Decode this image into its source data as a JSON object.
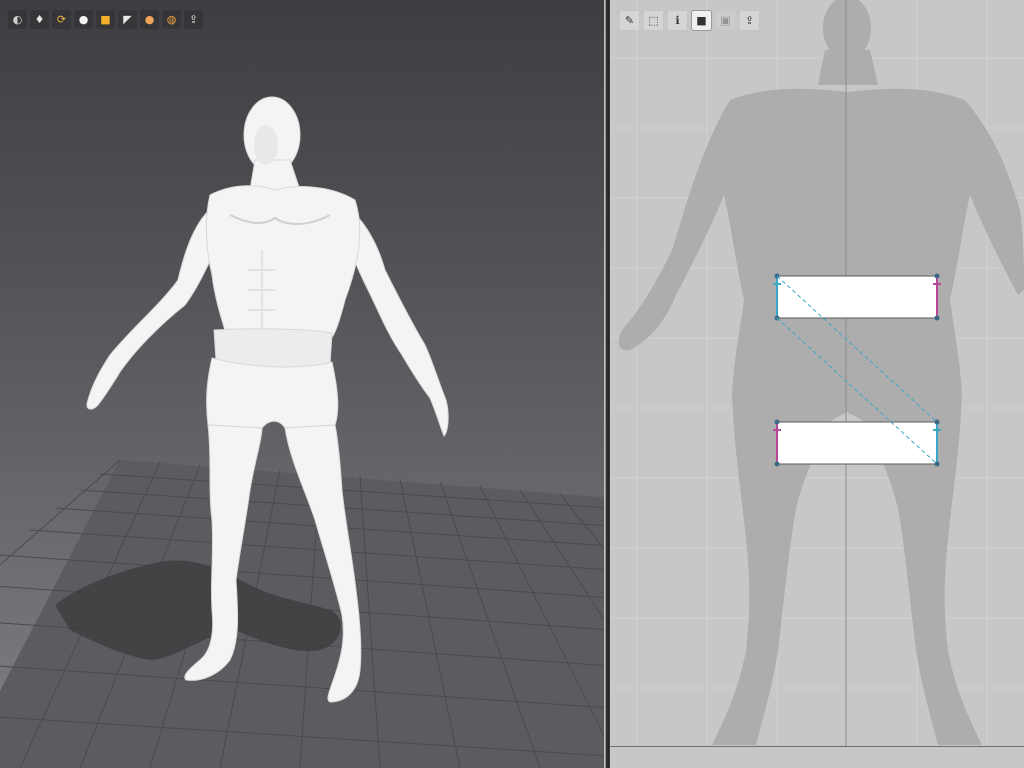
{
  "viewport_3d": {
    "toolbar": [
      {
        "icon": "orbit-icon",
        "glyph": "◐",
        "color": "#cfcfcf"
      },
      {
        "icon": "shirt-icon",
        "glyph": "♦",
        "color": "#e6e6e6"
      },
      {
        "icon": "refresh-icon",
        "glyph": "⟳",
        "color": "#f2b63c"
      },
      {
        "icon": "avatar-icon",
        "glyph": "●",
        "color": "#f2f2f2"
      },
      {
        "icon": "fabric-icon",
        "glyph": "■",
        "color": "#f3b02a"
      },
      {
        "icon": "flag-icon",
        "glyph": "◤",
        "color": "#e8e8e8"
      },
      {
        "icon": "person-icon",
        "glyph": "●",
        "color": "#f0a35a"
      },
      {
        "icon": "globe-icon",
        "glyph": "◍",
        "color": "#e9a23b"
      },
      {
        "icon": "export-icon",
        "glyph": "⇪",
        "color": "#dadada"
      }
    ],
    "ground_color": "#5b5c5f",
    "avatar_color": "#f4f4f4"
  },
  "viewport_2d": {
    "toolbar": [
      {
        "icon": "edit-pattern-icon",
        "glyph": "✎",
        "active": false,
        "disabled": false
      },
      {
        "icon": "transform-icon",
        "glyph": "⬚",
        "active": false,
        "disabled": false
      },
      {
        "icon": "info-icon",
        "glyph": "ℹ",
        "active": false,
        "disabled": false
      },
      {
        "icon": "fabric-select-icon",
        "glyph": "■",
        "active": true,
        "disabled": false
      },
      {
        "icon": "copy-icon",
        "glyph": "▣",
        "active": false,
        "disabled": true
      },
      {
        "icon": "upload-icon",
        "glyph": "⇪",
        "active": false,
        "disabled": false
      }
    ],
    "pattern_fill": "#ffffff",
    "seam_color": "#3aa6c8",
    "alt_seam_color": "#b8479a",
    "grid_color": "#d8d8d8",
    "silhouette_color": "#adadad"
  }
}
